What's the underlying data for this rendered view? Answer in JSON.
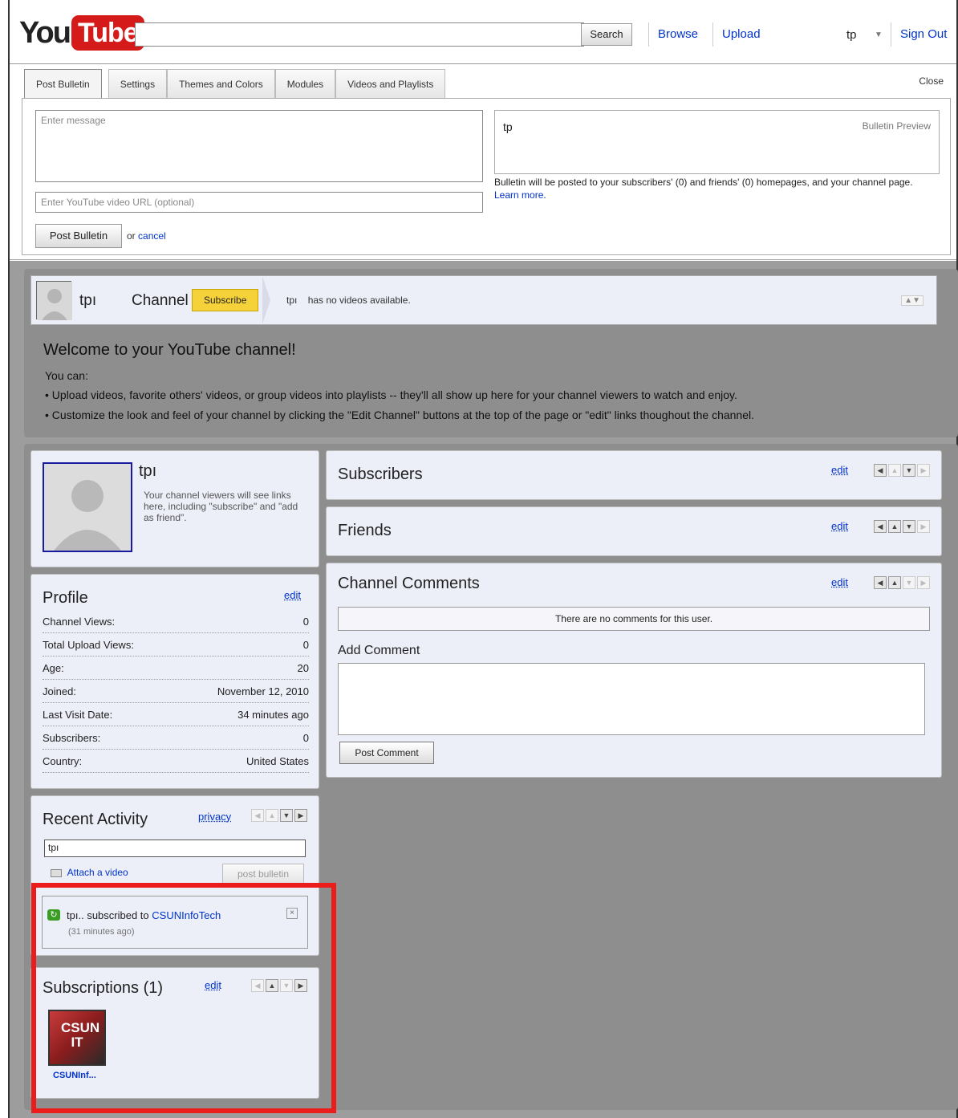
{
  "topbar": {
    "logo_you": "You",
    "logo_tube": "Tube",
    "search_label": "Search",
    "browse_label": "Browse",
    "upload_label": "Upload",
    "user_label": "tp",
    "signout_label": "Sign Out"
  },
  "editor": {
    "tabs": [
      "Post Bulletin",
      "Settings",
      "Themes and Colors",
      "Modules",
      "Videos and Playlists"
    ],
    "close_label": "Close",
    "message_placeholder": "Enter message",
    "url_placeholder": "Enter YouTube video URL (optional)",
    "post_label": "Post Bulletin",
    "or_text": "or",
    "cancel_label": "cancel",
    "preview_user": "tp",
    "preview_label": "Bulletin Preview",
    "note_text": "Bulletin will be posted to your subscribers' (0) and friends' (0) homepages, and your channel page.",
    "learn_more": "Learn more."
  },
  "channel": {
    "user": "tpı",
    "channel_label": "Channel",
    "subscribe_label": "Subscribe",
    "msg_user": "tpı",
    "msg_text": "has no videos available.",
    "welcome_title": "Welcome to your YouTube channel!",
    "welcome_lead": "You can:",
    "welcome_items": [
      "• Upload videos, favorite others' videos, or group videos into playlists -- they'll all show up here for your channel viewers to watch and enjoy.",
      "• Customize the look and feel of your channel by clicking the \"Edit Channel\" buttons at the top of the page or \"edit\" links thoughout the channel."
    ]
  },
  "user_card": {
    "name": "tpı",
    "hint": "Your channel viewers will see links here, including \"subscribe\" and \"add as friend\"."
  },
  "profile": {
    "title": "Profile",
    "edit_label": "edit",
    "rows": [
      {
        "label": "Channel Views:",
        "value": "0"
      },
      {
        "label": "Total Upload Views:",
        "value": "0"
      },
      {
        "label": "Age:",
        "value": "20"
      },
      {
        "label": "Joined:",
        "value": "November 12, 2010"
      },
      {
        "label": "Last Visit Date:",
        "value": "34 minutes ago"
      },
      {
        "label": "Subscribers:",
        "value": "0"
      },
      {
        "label": "Country:",
        "value": "United States"
      }
    ]
  },
  "recent_activity": {
    "title": "Recent Activity",
    "privacy_label": "privacy",
    "input_value": "tpı",
    "attach_label": "Attach a video",
    "post_label": "post bulletin",
    "item_user": "tpı..",
    "item_text": "subscribed to",
    "item_link": "CSUNInfoTech",
    "item_time": "(31 minutes ago)"
  },
  "subscriptions": {
    "title": "Subscriptions (1)",
    "edit_label": "edit",
    "thumb_text_1": "CSUN",
    "thumb_text_2": "IT",
    "thumb_caption": "CSUNInf..."
  },
  "subscribers": {
    "title": "Subscribers",
    "edit_label": "edit"
  },
  "friends": {
    "title": "Friends",
    "edit_label": "edit"
  },
  "comments": {
    "title": "Channel Comments",
    "edit_label": "edit",
    "empty_text": "There are no comments for this user.",
    "add_label": "Add Comment",
    "post_label": "Post Comment"
  },
  "colors": {
    "accent_link": "#0033cc",
    "subscribe_yellow": "#f5d13a",
    "highlight_red": "#ea1c1c",
    "panel_bg": "#eceef8"
  }
}
